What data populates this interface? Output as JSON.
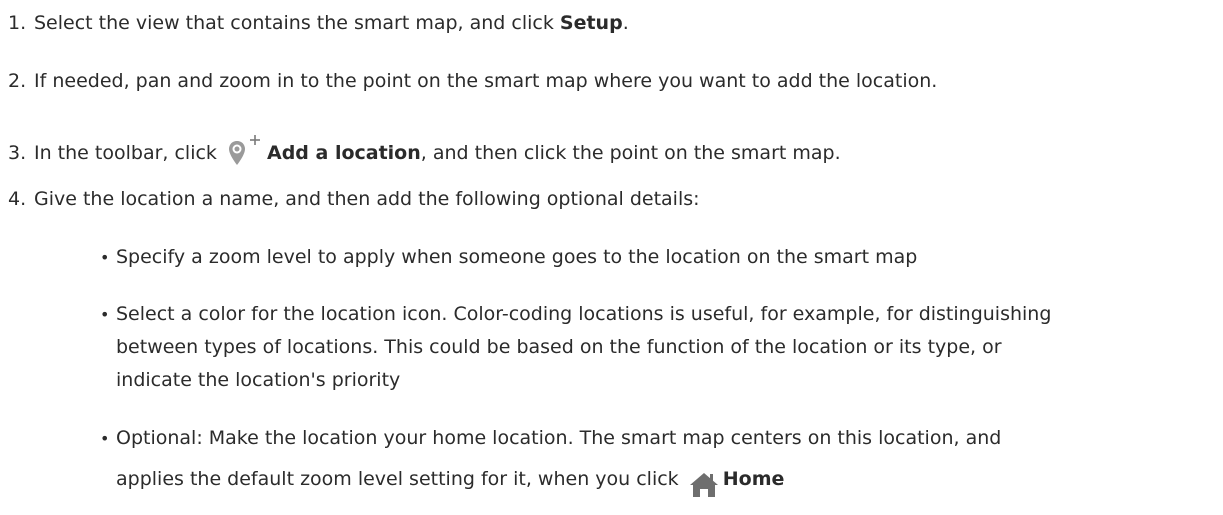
{
  "steps": [
    {
      "number": "1.",
      "text_before": "Select the view that contains the smart map, and click ",
      "bold": "Setup",
      "text_after": "."
    },
    {
      "number": "2.",
      "text": "If needed, pan and zoom in to the point on the smart map where you want to add the location."
    },
    {
      "number": "3.",
      "text_before": "In the toolbar, click ",
      "icon": "add-location-icon",
      "bold": "Add a location",
      "text_after": ", and then click the point on the smart map."
    },
    {
      "number": "4.",
      "text": "Give the location a name, and then add the following optional details:"
    }
  ],
  "bullets": [
    {
      "text": "Specify a zoom level to apply when someone goes to the location on the smart map"
    },
    {
      "line1": "Select a color for the location icon. Color-coding locations is useful, for example, for distinguishing",
      "line2": "between types of locations. This could be based on the function of the location or its type, or",
      "line3": "indicate the location's priority"
    },
    {
      "line1": "Optional: Make the location your home location. The smart map centers on this location, and",
      "line2_before": "applies the default zoom level setting for it, when you click ",
      "icon": "home-icon",
      "bold": "Home"
    }
  ],
  "colors": {
    "text": "#2b2b2b",
    "icon_gray": "#8c8c8c",
    "icon_dark": "#6e6e6e"
  }
}
